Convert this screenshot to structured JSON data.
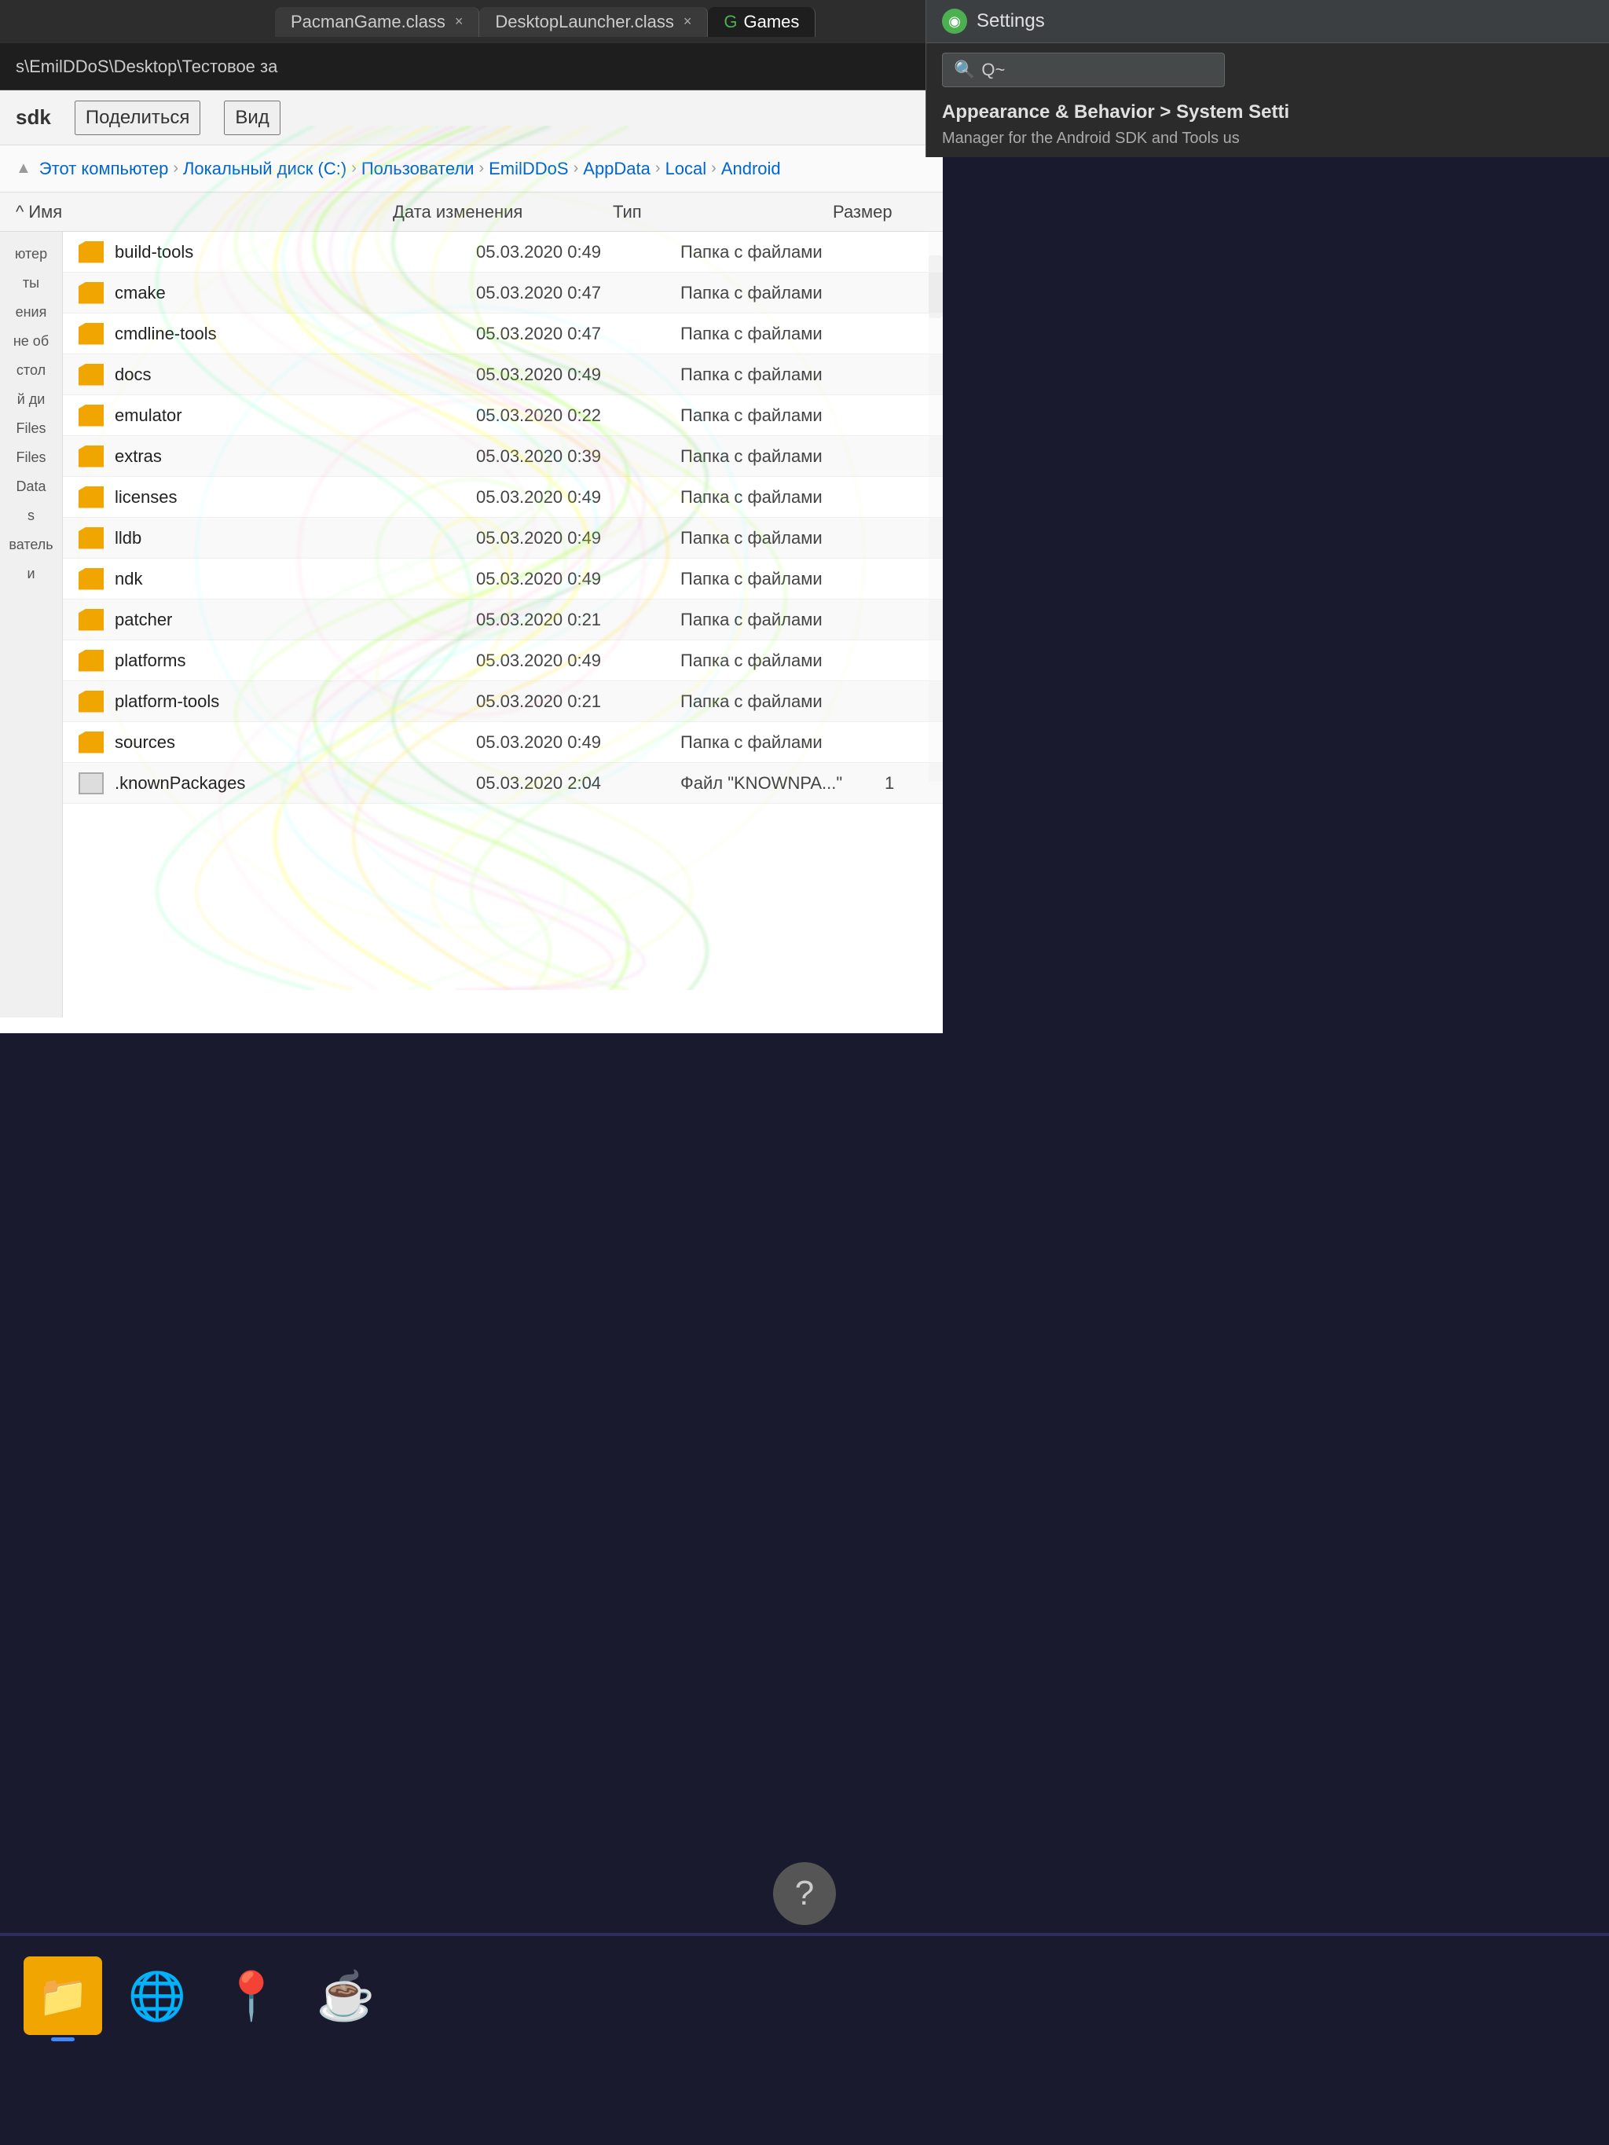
{
  "tabs": [
    {
      "label": "PacmanGame.class",
      "active": false,
      "icon": "P"
    },
    {
      "label": "DesktopLauncher.class",
      "active": false,
      "icon": "D"
    },
    {
      "label": "Games",
      "active": true,
      "icon": "G"
    }
  ],
  "address_bar": {
    "path": "s\\EmilDDoS\\Desktop\\Тестовое за"
  },
  "settings": {
    "title": "Settings",
    "icon_char": "◉",
    "search_placeholder": "Q~",
    "breadcrumb": "Appearance & Behavior  >  System Setti",
    "sub_description": "Manager for the Android SDK and Tools us"
  },
  "explorer": {
    "title": "sdk",
    "toolbar_buttons": [
      "Поделиться",
      "Вид"
    ],
    "breadcrumb_parts": [
      "Этот компьютер",
      "Локальный диск (C:)",
      "Пользователи",
      "EmilDDoS",
      "AppData",
      "Local",
      "Android"
    ],
    "column_headers": {
      "name": "Имя",
      "date": "Дата изменения",
      "type": "Тип",
      "size": "Размер"
    },
    "sidebar_items": [
      "ютер",
      "ты",
      "ения",
      "не об",
      "стол",
      "й ди",
      "Files",
      "Files",
      "Data",
      "s",
      "ватель",
      "и"
    ],
    "files": [
      {
        "name": "build-tools",
        "date": "05.03.2020 0:49",
        "type": "Папка с файлами",
        "size": "",
        "is_folder": true
      },
      {
        "name": "cmake",
        "date": "05.03.2020 0:47",
        "type": "Папка с файлами",
        "size": "",
        "is_folder": true
      },
      {
        "name": "cmdline-tools",
        "date": "05.03.2020 0:47",
        "type": "Папка с файлами",
        "size": "",
        "is_folder": true
      },
      {
        "name": "docs",
        "date": "05.03.2020 0:49",
        "type": "Папка с файлами",
        "size": "",
        "is_folder": true
      },
      {
        "name": "emulator",
        "date": "05.03.2020 0:22",
        "type": "Папка с файлами",
        "size": "",
        "is_folder": true
      },
      {
        "name": "extras",
        "date": "05.03.2020 0:39",
        "type": "Папка с файлами",
        "size": "",
        "is_folder": true
      },
      {
        "name": "licenses",
        "date": "05.03.2020 0:49",
        "type": "Папка с файлами",
        "size": "",
        "is_folder": true
      },
      {
        "name": "lldb",
        "date": "05.03.2020 0:49",
        "type": "Папка с файлами",
        "size": "",
        "is_folder": true
      },
      {
        "name": "ndk",
        "date": "05.03.2020 0:49",
        "type": "Папка с файлами",
        "size": "",
        "is_folder": true
      },
      {
        "name": "patcher",
        "date": "05.03.2020 0:21",
        "type": "Папка с файлами",
        "size": "",
        "is_folder": true
      },
      {
        "name": "platforms",
        "date": "05.03.2020 0:49",
        "type": "Папка с файлами",
        "size": "",
        "is_folder": true
      },
      {
        "name": "platform-tools",
        "date": "05.03.2020 0:21",
        "type": "Папка с файлами",
        "size": "",
        "is_folder": true
      },
      {
        "name": "sources",
        "date": "05.03.2020 0:49",
        "type": "Папка с файлами",
        "size": "",
        "is_folder": true
      },
      {
        "name": ".knownPackages",
        "date": "05.03.2020 2:04",
        "type": "Файл \"KNOWNPA...\"",
        "size": "1",
        "is_folder": false
      }
    ]
  },
  "taskbar": {
    "icons": [
      {
        "name": "file-explorer-icon",
        "emoji": "📁",
        "color": "#f0a500",
        "has_indicator": true
      },
      {
        "name": "chrome-icon",
        "emoji": "🌐",
        "color": "transparent",
        "has_indicator": false
      },
      {
        "name": "maps-icon",
        "emoji": "📍",
        "color": "transparent",
        "has_indicator": false
      },
      {
        "name": "java-icon",
        "emoji": "☕",
        "color": "transparent",
        "has_indicator": false
      }
    ]
  },
  "help_button_label": "?",
  "colors": {
    "folder_icon": "#f0a500",
    "settings_green": "#4caf50",
    "accent_blue": "#4488ff",
    "taskbar_bg": "#1a1a2e"
  }
}
